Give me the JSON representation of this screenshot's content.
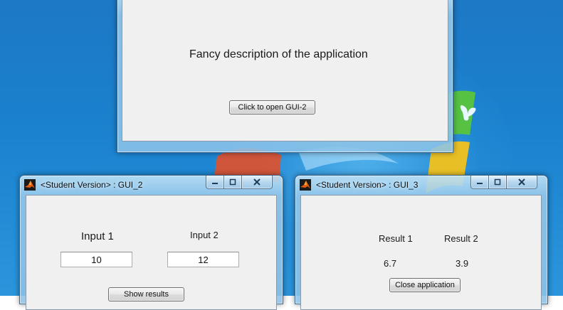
{
  "main_window": {
    "description": "Fancy description of the application",
    "open_button_label": "Click to open GUI-2"
  },
  "gui2_window": {
    "title": "<Student Version> : GUI_2",
    "input1_label": "Input 1",
    "input2_label": "Input 2",
    "input1_value": "10",
    "input2_value": "12",
    "show_results_label": "Show results",
    "controls": {
      "minimize": "minimize",
      "maximize": "maximize",
      "close": "close"
    }
  },
  "gui3_window": {
    "title": "<Student Version> : GUI_3",
    "result1_label": "Result 1",
    "result2_label": "Result 2",
    "result1_value": "6.7",
    "result2_value": "3.9",
    "close_app_label": "Close application",
    "controls": {
      "minimize": "minimize",
      "maximize": "maximize",
      "close": "close"
    }
  },
  "icons": {
    "window_app_icon": "matlab-icon",
    "minimize": "minimize-icon",
    "maximize": "maximize-icon",
    "close": "close-icon"
  },
  "colors": {
    "desktop": "#1a82cf",
    "client_background": "#f0f0f0",
    "window_frame": "#9cc8e8"
  }
}
